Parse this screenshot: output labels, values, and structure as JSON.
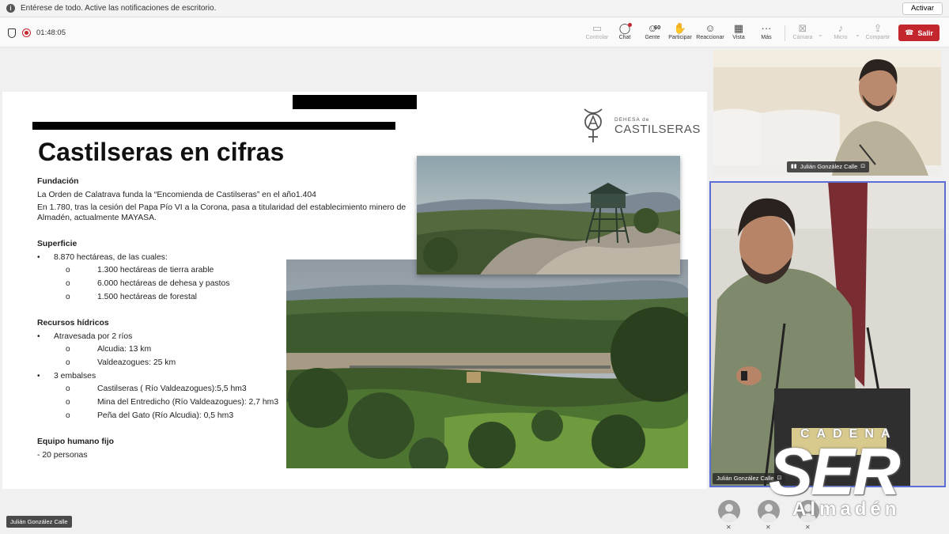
{
  "notification": {
    "message": "Entérese de todo. Active las notificaciones de escritorio.",
    "action_label": "Activar"
  },
  "toolbar": {
    "timer": "01:48:05",
    "controlar": "Controlar",
    "chat": "Chat",
    "gente": "Gente",
    "gente_count": "60",
    "participar": "Participar",
    "reaccionar": "Reaccionar",
    "vista": "Vista",
    "mas": "Más",
    "camara": "Cámara",
    "micro": "Micro",
    "compartir": "Compartir",
    "salir": "Salir",
    "accent_color": "#c4262e"
  },
  "slide": {
    "logo_small": "DEHESA de",
    "logo_big": "CASTILSERAS",
    "title": "Castilseras en cifras",
    "fundacion": {
      "heading": "Fundación",
      "line1": "La Orden de Calatrava funda la “Encomienda de Castilseras” en  el año1.404",
      "line2": "En 1.780, tras la cesión del Papa Pío VI a la Corona, pasa a titularidad del establecimiento minero de Almadén, actualmente MAYASA."
    },
    "superficie": {
      "heading": "Superficie",
      "main": "8.870 hectáreas, de las cuales:",
      "items": [
        "1.300 hectáreas de tierra arable",
        "6.000 hectáreas de dehesa y pastos",
        "1.500 hectáreas de forestal"
      ]
    },
    "recursos": {
      "heading": "Recursos hídricos",
      "rios": "Atravesada por 2 ríos",
      "rios_items": [
        "Alcudia: 13 km",
        "Valdeazogues: 25 km"
      ],
      "embalses": "3 embalses",
      "embalses_items": [
        "Castilseras ( Río Valdeazogues):5,5 hm3",
        "Mina del Entredicho (Río Valdeazogues): 2,7 hm3",
        "Peña del Gato (Río Alcudia): 0,5 hm3"
      ]
    },
    "equipo": {
      "heading": "Equipo humano fijo",
      "value": "- 20 personas"
    },
    "bullet_main": "•",
    "bullet_sub": "o"
  },
  "participants": {
    "tile1_name": "Julián González Calle",
    "tile2_name": "Julián González Calle",
    "self_name": "Julián González Calle"
  },
  "watermark": {
    "cadena": "CADENA",
    "ser": "SER",
    "city": "Almadén"
  }
}
